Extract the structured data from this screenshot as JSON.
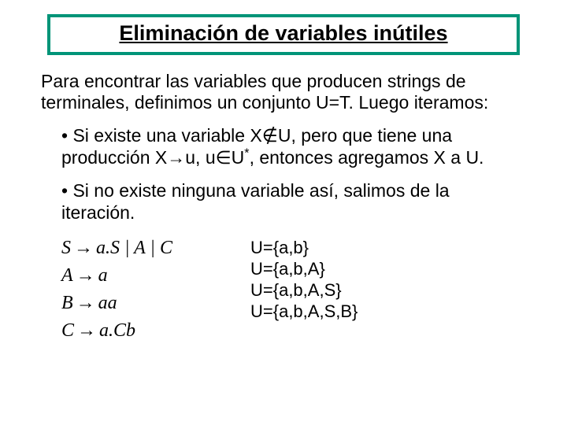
{
  "title": "Eliminación de variables inútiles",
  "intro": "Para encontrar las variables que producen strings de terminales, definimos un conjunto U=T. Luego iteramos:",
  "bullets": {
    "b1_pre": "• Si existe una variable X",
    "b1_notin": "∉",
    "b1_mid": "U, pero que tiene una producción X",
    "b1_to": "→",
    "b1_mid2": "u, u",
    "b1_in": "∈",
    "b1_post": "U*, entonces agregamos X a U.",
    "b2": "• Si no existe ninguna variable así, salimos de la iteración."
  },
  "grammar": {
    "r1_lhs": "S",
    "r1_rhs": "a.S | A | C",
    "r2_lhs": "A",
    "r2_rhs": "a",
    "r3_lhs": "B",
    "r3_rhs": "aa",
    "r4_lhs": "C",
    "r4_rhs": "a.Cb",
    "arrow": "→"
  },
  "sets": {
    "u1": "U={a,b}",
    "u2": "U={a,b,A}",
    "u3": "U={a,b,A,S}",
    "u4": "U={a,b,A,S,B}"
  }
}
